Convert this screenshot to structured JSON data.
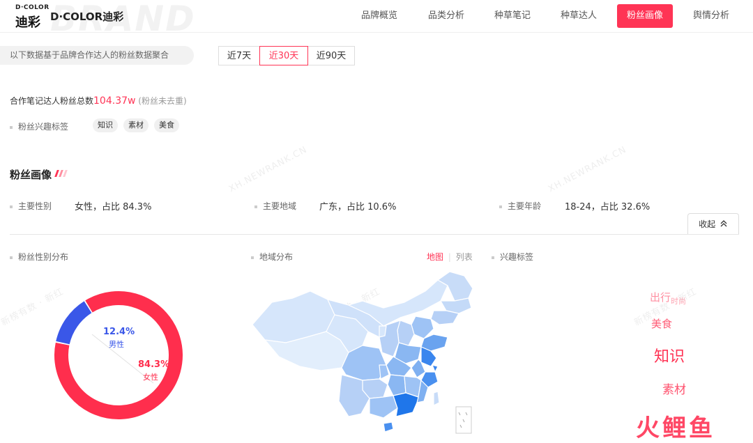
{
  "header": {
    "logo_top": "D·COLOR",
    "logo_cn": "迪彩",
    "brand_name": "D·COLOR迪彩",
    "brand_bg": "BRAND",
    "nav": [
      {
        "label": "品牌概览",
        "active": false
      },
      {
        "label": "品类分析",
        "active": false
      },
      {
        "label": "种草笔记",
        "active": false
      },
      {
        "label": "种草达人",
        "active": false
      },
      {
        "label": "粉丝画像",
        "active": true
      },
      {
        "label": "舆情分析",
        "active": false
      }
    ]
  },
  "filter": {
    "info_text": "以下数据基于品牌合作达人的粉丝数据聚合",
    "ranges": [
      {
        "label": "近7天",
        "active": false
      },
      {
        "label": "近30天",
        "active": true
      },
      {
        "label": "近90天",
        "active": false
      }
    ]
  },
  "totals": {
    "label": "合作笔记达人粉丝总数",
    "value": "104.37w",
    "note": "(粉丝未去重)"
  },
  "interest": {
    "label": "粉丝兴趣标签",
    "tags": [
      "知识",
      "素材",
      "美食"
    ]
  },
  "portrait": {
    "title": "粉丝画像",
    "summary": [
      {
        "label": "主要性别",
        "value": "女性，占比 84.3%"
      },
      {
        "label": "主要地域",
        "value": "广东，占比 10.6%"
      },
      {
        "label": "主要年龄",
        "value": "18-24，占比 32.6%"
      }
    ],
    "collapse_label": "收起"
  },
  "gender_section": {
    "label": "粉丝性别分布",
    "male": {
      "percent": "12.4%",
      "label": "男性",
      "value": 12.4,
      "color": "#3a57e8"
    },
    "female": {
      "percent": "84.3%",
      "label": "女性",
      "value": 84.3,
      "color": "#ff2e4d"
    }
  },
  "region_section": {
    "label": "地域分布",
    "toggle_map": "地图",
    "toggle_list": "列表"
  },
  "interest_section": {
    "label": "兴趣标签",
    "words": [
      {
        "text": "出行"
      },
      {
        "text": "时尚"
      },
      {
        "text": "美食"
      },
      {
        "text": "知识"
      },
      {
        "text": "素材"
      }
    ]
  },
  "watermarks": [
    "XH.NEWRANK.CN",
    "XH.NEWRANK.CN",
    "新榜有数 · 新红",
    "新榜有数 · 新红",
    "新榜有数 · 新红"
  ],
  "corner_logo": "火鲤鱼",
  "colors": {
    "accent": "#ff3455",
    "male": "#3a57e8",
    "female": "#ff2e4d",
    "map_light": "#d6e6fb",
    "map_mid": "#9ec3f5",
    "map_dark": "#2f80ed"
  }
}
